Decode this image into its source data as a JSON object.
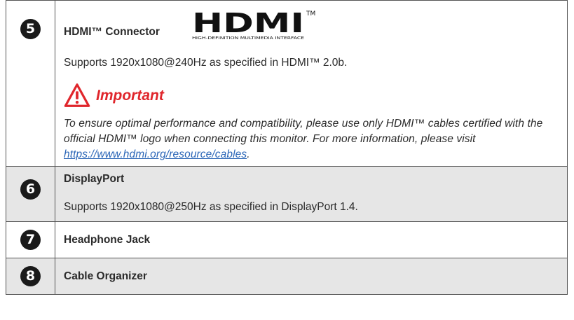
{
  "rows": [
    {
      "number": "5",
      "title": "HDMI™ Connector",
      "logo_text": "HDMI",
      "logo_trademark": "TM",
      "logo_tagline": "HIGH-DEFINITION MULTIMEDIA INTERFACE",
      "description": "Supports 1920x1080@240Hz as specified in HDMI™ 2.0b.",
      "important_label": "Important",
      "note_text": "To ensure optimal performance and compatibility, please use only HDMI™ cables certified with the official HDMI™ logo when connecting this monitor. For more information, please visit ",
      "note_link": "https://www.hdmi.org/resource/cables",
      "note_end": "."
    },
    {
      "number": "6",
      "title": "DisplayPort",
      "description": "Supports 1920x1080@250Hz as specified in DisplayPort 1.4."
    },
    {
      "number": "7",
      "title": "Headphone Jack"
    },
    {
      "number": "8",
      "title": "Cable Organizer"
    }
  ],
  "colors": {
    "important": "#e0262c",
    "link": "#2b66b7",
    "shaded_row": "#e6e6e6",
    "badge": "#1a1a1a"
  }
}
